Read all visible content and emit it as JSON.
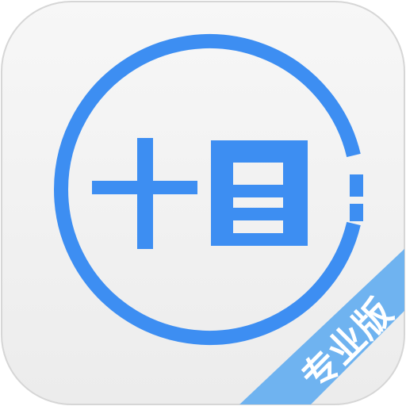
{
  "app_icon": {
    "logo_name": "shimu-logo-icon",
    "badge_label": "专业版",
    "colors": {
      "background_top": "#f7f7f7",
      "background_bottom": "#ececec",
      "border": "#d6d6d6",
      "accent": "#3d8ef2",
      "ribbon": "#6fb3f0",
      "ribbon_text": "#ffffff"
    }
  }
}
